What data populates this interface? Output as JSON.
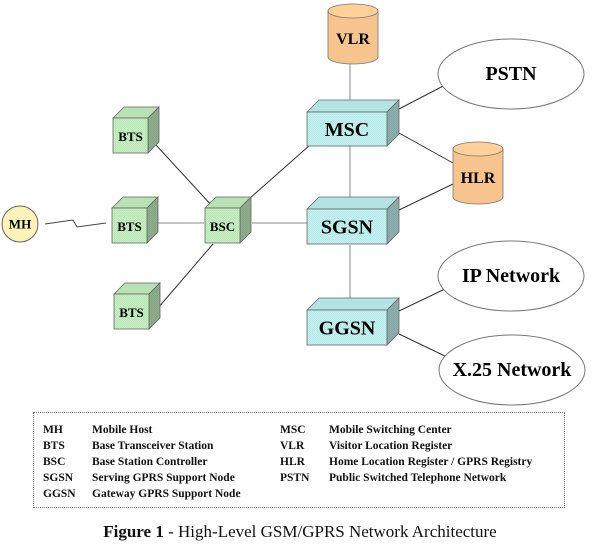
{
  "diagram": {
    "title": "High-Level GSM/GPRS Network Architecture",
    "nodes": {
      "mh": {
        "label": "MH",
        "shape": "circle",
        "color": "#fbf3b8"
      },
      "bts1": {
        "label": "BTS",
        "shape": "cube",
        "color": "#c6f2c2"
      },
      "bts2": {
        "label": "BTS",
        "shape": "cube",
        "color": "#c6f2c2"
      },
      "bts3": {
        "label": "BTS",
        "shape": "cube",
        "color": "#c6f2c2"
      },
      "bsc": {
        "label": "BSC",
        "shape": "cube",
        "color": "#c6f2c2"
      },
      "msc": {
        "label": "MSC",
        "shape": "box",
        "color": "#c2f4f4"
      },
      "sgsn": {
        "label": "SGSN",
        "shape": "box",
        "color": "#c2f4f4"
      },
      "ggsn": {
        "label": "GGSN",
        "shape": "box",
        "color": "#c2f4f4"
      },
      "vlr": {
        "label": "VLR",
        "shape": "cylinder",
        "color": "#f7c48e"
      },
      "hlr": {
        "label": "HLR",
        "shape": "cylinder",
        "color": "#f7c48e"
      },
      "pstn": {
        "label": "PSTN",
        "shape": "ellipse",
        "color": "#ffffff"
      },
      "ip": {
        "label": "IP Network",
        "shape": "ellipse",
        "color": "#ffffff"
      },
      "x25": {
        "label": "X.25 Network",
        "shape": "ellipse",
        "color": "#ffffff"
      }
    },
    "edges": [
      {
        "from": "mh",
        "to": "bts2",
        "type": "wireless"
      },
      {
        "from": "bts1",
        "to": "bsc",
        "type": "wired"
      },
      {
        "from": "bts2",
        "to": "bsc",
        "type": "wired"
      },
      {
        "from": "bts3",
        "to": "bsc",
        "type": "wired"
      },
      {
        "from": "bsc",
        "to": "msc",
        "type": "wired"
      },
      {
        "from": "bsc",
        "to": "sgsn",
        "type": "wired"
      },
      {
        "from": "vlr",
        "to": "msc",
        "type": "wired"
      },
      {
        "from": "msc",
        "to": "pstn",
        "type": "wired"
      },
      {
        "from": "msc",
        "to": "hlr",
        "type": "wired"
      },
      {
        "from": "msc",
        "to": "sgsn",
        "type": "wired"
      },
      {
        "from": "sgsn",
        "to": "hlr",
        "type": "wired"
      },
      {
        "from": "sgsn",
        "to": "ggsn",
        "type": "wired"
      },
      {
        "from": "ggsn",
        "to": "ip",
        "type": "wired"
      },
      {
        "from": "ggsn",
        "to": "x25",
        "type": "wired"
      }
    ]
  },
  "legend": {
    "left": [
      {
        "abbr": "MH",
        "desc": "Mobile Host"
      },
      {
        "abbr": "BTS",
        "desc": "Base Transceiver Station"
      },
      {
        "abbr": "BSC",
        "desc": "Base Station Controller"
      },
      {
        "abbr": "SGSN",
        "desc": "Serving GPRS Support Node"
      },
      {
        "abbr": "GGSN",
        "desc": "Gateway GPRS Support Node"
      }
    ],
    "right": [
      {
        "abbr": "MSC",
        "desc": "Mobile Switching Center"
      },
      {
        "abbr": "VLR",
        "desc": "Visitor Location Register"
      },
      {
        "abbr": "HLR",
        "desc": "Home Location Register / GPRS Registry"
      },
      {
        "abbr": "PSTN",
        "desc": "Public Switched Telephone Network"
      }
    ]
  },
  "caption": {
    "figure": "Figure 1",
    "separator": " - ",
    "text": "High-Level GSM/GPRS Network Architecture"
  }
}
